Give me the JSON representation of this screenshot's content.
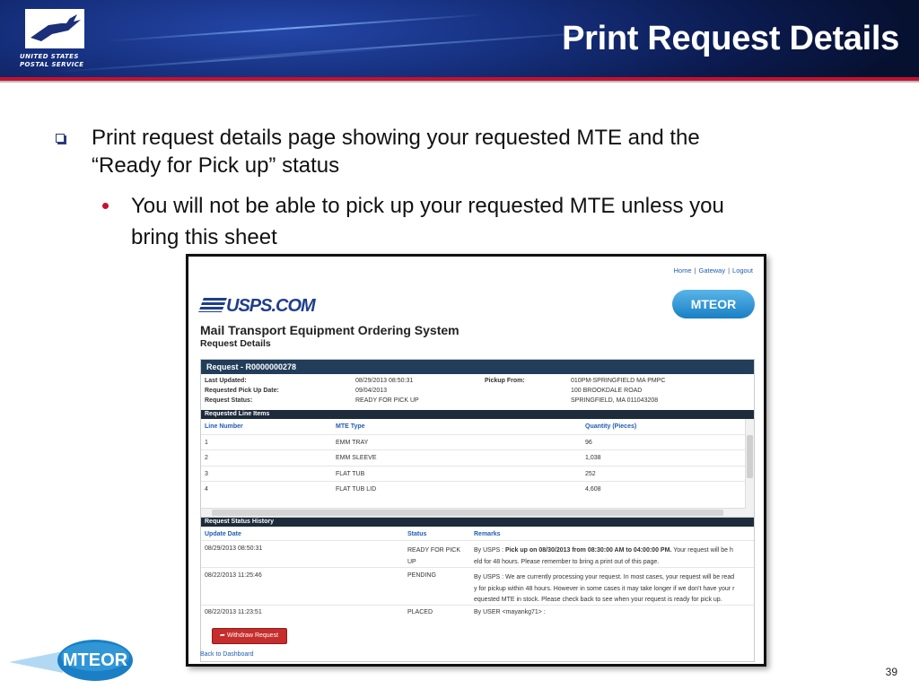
{
  "header": {
    "title": "Print Request Details",
    "org_name": "UNITED STATES POSTAL SERVICE",
    "org_line1": "UNITED STATES",
    "org_line2": "POSTAL SERVICE"
  },
  "bullets": {
    "level1_line1": "Print request details page showing your requested MTE and the",
    "level1_line2": "“Ready for Pick up” status",
    "level2_line1": "You will not be able to pick up your requested MTE unless you",
    "level2_line2": "bring this sheet"
  },
  "screenshot": {
    "top_links": {
      "home": "Home",
      "gateway": "Gateway",
      "logout": "Logout",
      "separator": "|"
    },
    "site_logo": "USPS.COM",
    "app_logo": "MTEOR",
    "system_title": "Mail Transport Equipment Ordering System",
    "page_subtitle": "Request Details",
    "request_header": "Request - R0000000278",
    "info": {
      "last_updated_label": "Last Updated:",
      "last_updated_value": "08/29/2013 08:50:31",
      "pickup_date_label": "Requested Pick Up Date:",
      "pickup_date_value": "09/04/2013",
      "status_label": "Request Status:",
      "status_value": "READY FOR PICK UP",
      "pickup_from_label": "Pickup From:",
      "pickup_from_line1": "010PM-SPRINGFIELD MA PMPC",
      "pickup_from_line2": "100 BROOKDALE ROAD",
      "pickup_from_line3": "SPRINGFIELD, MA 011043208"
    },
    "line_items": {
      "section_title": "Requested Line Items",
      "columns": [
        "Line Number",
        "MTE Type",
        "Quantity (Pieces)"
      ],
      "rows": [
        [
          "1",
          "EMM TRAY",
          "96"
        ],
        [
          "2",
          "EMM SLEEVE",
          "1,038"
        ],
        [
          "3",
          "FLAT TUB",
          "252"
        ],
        [
          "4",
          "FLAT TUB LID",
          "4,608"
        ]
      ]
    },
    "history": {
      "section_title": "Request Status History",
      "columns": [
        "Update Date",
        "Status",
        "Remarks"
      ],
      "rows": [
        {
          "date": "08/29/2013 08:50:31",
          "status_line1": "READY FOR PICK",
          "status_line2": "UP",
          "remark_by": "By USPS :",
          "remark_bold": "Pick up on 08/30/2013 from  08:30:00 AM to  04:00:00 PM.",
          "remark_line1_rest": "Your request will be h",
          "remark_line2": "eld for 48 hours. Please remember to bring a print out of this page."
        },
        {
          "date": "08/22/2013 11:25:46",
          "status_line1": "PENDING",
          "remark_line1": "By USPS :  We are currently processing your request. In most cases, your request will be read",
          "remark_line2": "y for pickup within 48 hours. However in some cases it may take longer if we don't have your r",
          "remark_line3": "equested MTE in stock. Please check back to see when your request is ready for pick up."
        },
        {
          "date": "08/22/2013 11:23:51",
          "status_line1": "PLACED",
          "remark_line1": "By USER  <mayankg71> :"
        }
      ]
    },
    "withdraw_button": "Withdraw Request",
    "back_link": "Back to Dashboard"
  },
  "footer": {
    "logo_text": "MTEOR",
    "slide_number": "39"
  },
  "colors": {
    "banner_blue": "#16307e",
    "accent_red": "#c8102e",
    "panel_header": "#213d5a",
    "link_blue": "#1f5db3",
    "mteor_blue": "#1a7fc4"
  }
}
